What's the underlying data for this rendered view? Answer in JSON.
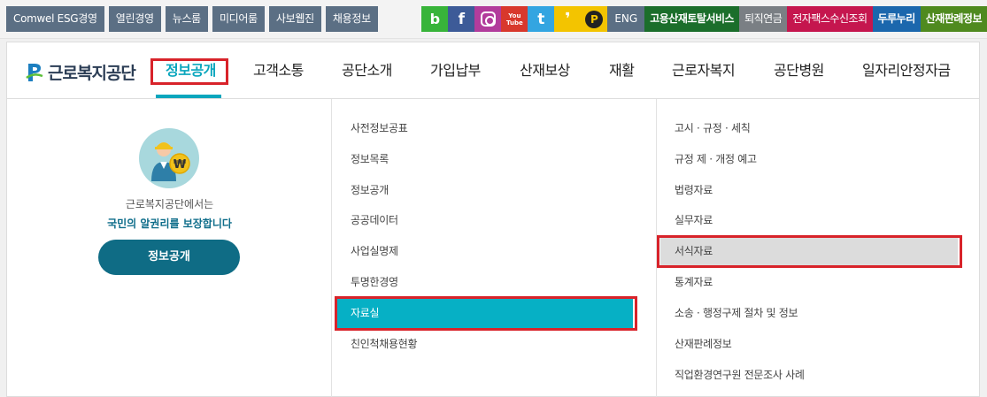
{
  "top_links": [
    "Comwel ESG경영",
    "열린경영",
    "뉴스룸",
    "미디어룸",
    "사보웹진",
    "채용정보"
  ],
  "social": {
    "blog": "b",
    "facebook": "f",
    "youtube_top": "You",
    "youtube_bottom": "Tube",
    "twitter": "t",
    "kakaostory": "❜",
    "kakaopay": "P"
  },
  "lang": "ENG",
  "services": [
    "고용산재토탈서비스",
    "퇴직연금",
    "전자팩스수신조회",
    "두루누리",
    "산재판례정보"
  ],
  "logo": "근로복지공단",
  "nav": [
    "정보공개",
    "고객소통",
    "공단소개",
    "가입납부",
    "산재보상",
    "재활",
    "근로자복지",
    "공단병원",
    "일자리안정자금"
  ],
  "left_panel": {
    "line1": "근로복지공단에서는",
    "line2": "국민의 알권리를 보장합니다",
    "button": "정보공개"
  },
  "mid_menu": [
    "사전정보공표",
    "정보목록",
    "정보공개",
    "공공데이터",
    "사업실명제",
    "투명한경영",
    "자료실",
    "친인척채용현황"
  ],
  "right_menu": [
    "고시 · 규정 · 세칙",
    "규정 제 · 개정 예고",
    "법령자료",
    "실무자료",
    "서식자료",
    "통계자료",
    "소송 · 행정구제 절차 및 정보",
    "산재판례정보",
    "직업환경연구원 전문조사 사례"
  ],
  "colors": {
    "accent": "#0aa6bd",
    "active_item": "#06b0c5",
    "highlight": "#d8232a",
    "cta": "#0f6c85"
  }
}
